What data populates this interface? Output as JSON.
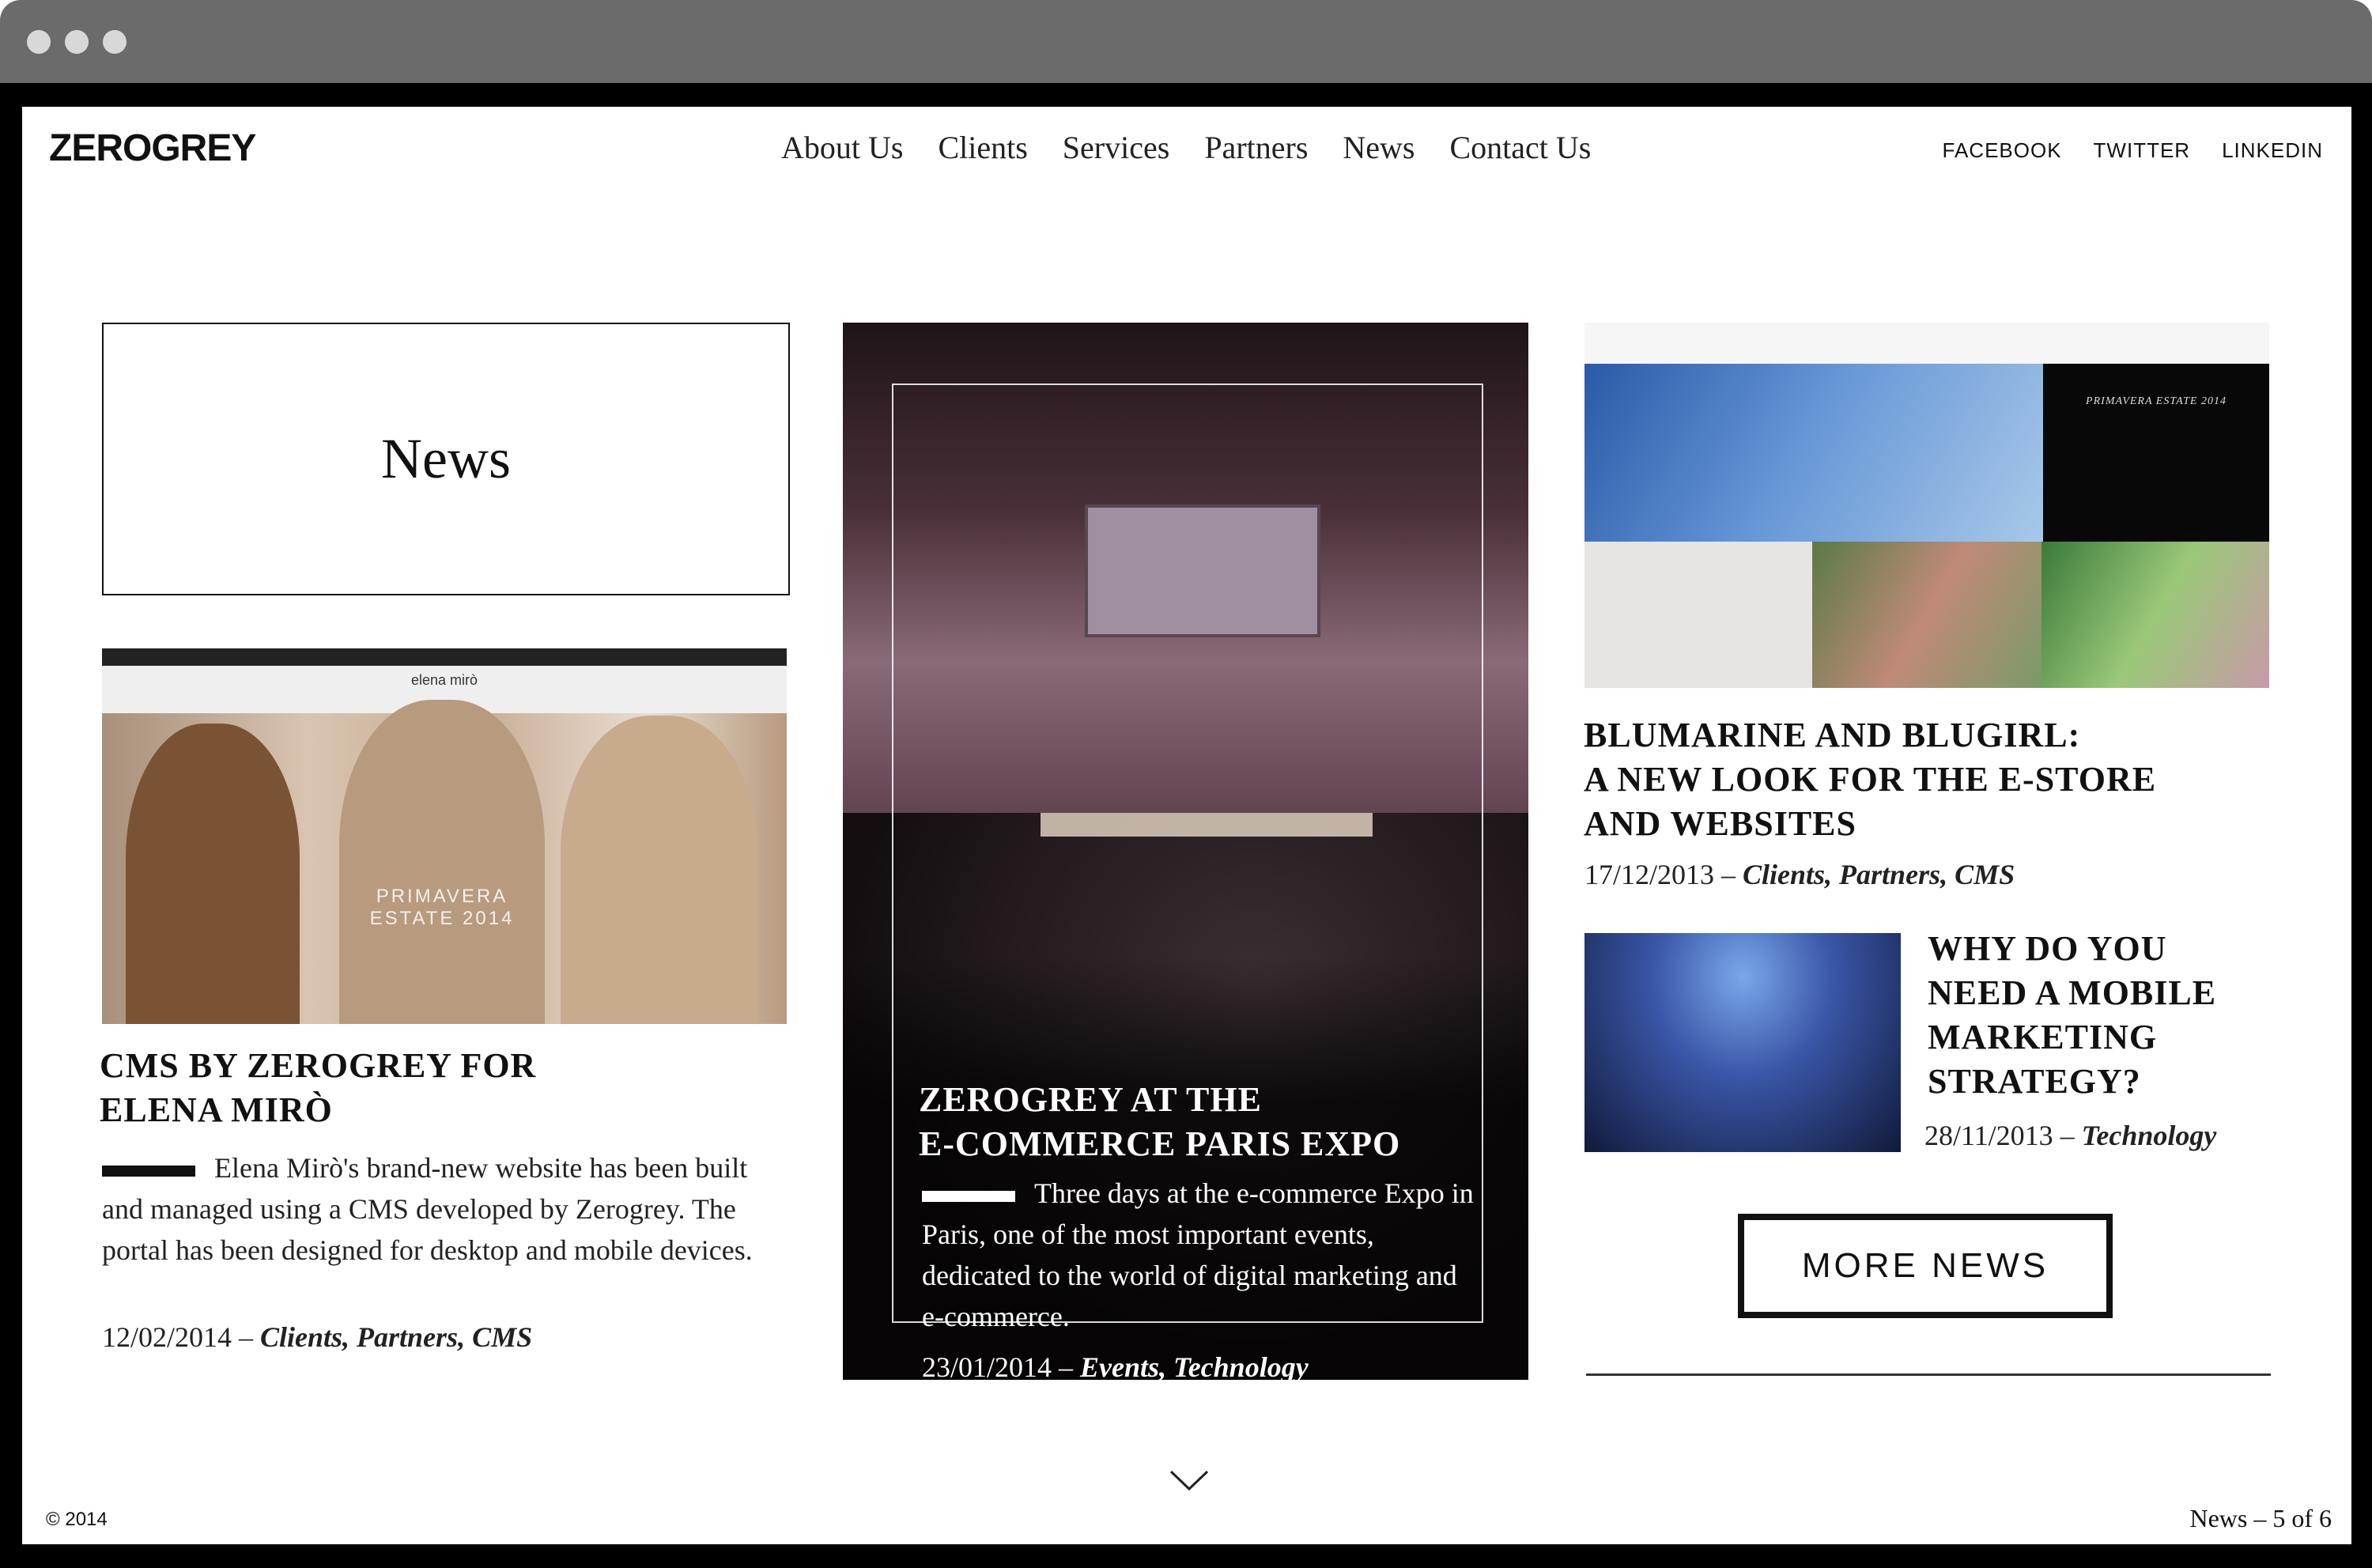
{
  "header": {
    "logo": "ZEROGREY",
    "nav": [
      "About Us",
      "Clients",
      "Services",
      "Partners",
      "News",
      "Contact Us"
    ],
    "social": [
      "FACEBOOK",
      "TWITTER",
      "LINKEDIN"
    ]
  },
  "section_title": "News",
  "articles": [
    {
      "title_line1": "CMS BY ZEROGREY FOR",
      "title_line2": "ELENA MIRÒ",
      "excerpt": "Elena Mirò's brand-new website has been built and managed using a CMS developed by Zerogrey. The portal has been designed for desktop and mobile devices.",
      "date": "12/02/2014 –",
      "tags": "Clients, Partners, CMS",
      "image_text": "PRIMAVERA ESTATE 2014",
      "image_brand": "elena mirò"
    },
    {
      "title_line1": "ZEROGREY AT THE",
      "title_line2": "E-COMMERCE PARIS EXPO",
      "excerpt": "Three days at the e-commerce Expo in Paris, one of the most important events, dedicated to the world of digital marketing and e-commerce.",
      "date": "23/01/2014 –",
      "tags": "Events, Technology"
    },
    {
      "title_line1": "BLUMARINE AND BLUGIRL:",
      "title_line2": "A NEW LOOK FOR THE E-STORE",
      "title_line3": "AND WEBSITES",
      "date": "17/12/2013 –",
      "tags": "Clients, Partners, CMS",
      "image_text": "PRIMAVERA ESTATE 2014"
    },
    {
      "title_line1": "WHY DO YOU",
      "title_line2": "NEED A MOBILE",
      "title_line3": "MARKETING",
      "title_line4": "STRATEGY?",
      "date": "28/11/2013 –",
      "tags": "Technology"
    }
  ],
  "more_button": "MORE NEWS",
  "footer": {
    "copyright": "© 2014",
    "pager": "News – 5 of 6"
  },
  "colors": {
    "chrome": "#6b6b6b",
    "frame": "#000000",
    "text": "#111111"
  }
}
